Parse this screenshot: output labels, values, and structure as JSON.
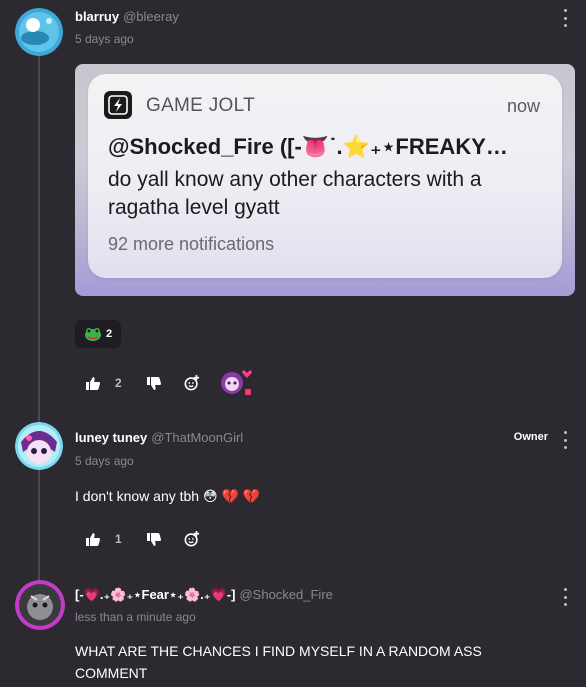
{
  "comments": [
    {
      "username": "blarruy",
      "handle": "@bleeray",
      "time": "5 days ago",
      "notification": {
        "app_name": "GAME JOLT",
        "when": "now",
        "title": "@Shocked_Fire ([-👅˙.⭐₊⋆FREAKY…",
        "body": "do yall know any other characters with a ragatha level gyatt",
        "more": "92 more notifications"
      },
      "reaction_count": "2",
      "like_count": "2"
    },
    {
      "username": "luney tuney",
      "handle": "@ThatMoonGirl",
      "badge": "Owner",
      "time": "5 days ago",
      "text": "I don't know any tbh 😳 💔 💔",
      "like_count": "1"
    },
    {
      "username": "[-💗.₊🌸₊⋆Fear⋆₊🌸.₊💗-]",
      "handle": "@Shocked_Fire",
      "time": "less than a minute ago",
      "text": "WHAT ARE THE CHANCES I FIND MYSELF IN A RANDOM ASS COMMENT"
    }
  ],
  "colors": {
    "background": "#2c2a30",
    "muted_text": "#8b8891",
    "thread_line": "#4a4750"
  }
}
